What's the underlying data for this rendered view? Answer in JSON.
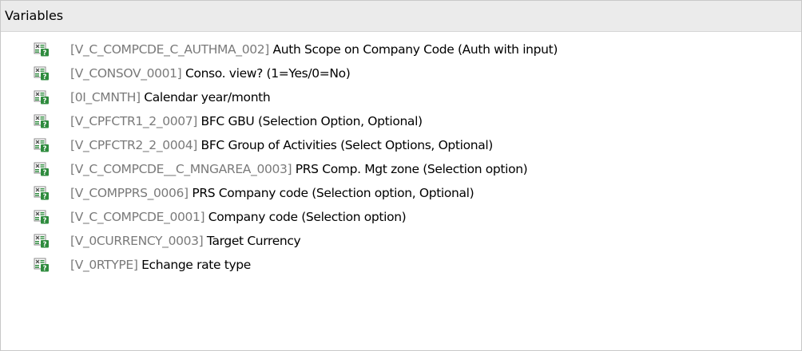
{
  "panel": {
    "title": "Variables"
  },
  "variables": [
    {
      "tech": "[V_C_COMPCDE_C_AUTHMA_002]",
      "description": "Auth Scope on Company Code (Auth with input)"
    },
    {
      "tech": "[V_CONSOV_0001]",
      "description": "Conso. view? (1=Yes/0=No)"
    },
    {
      "tech": "[0I_CMNTH]",
      "description": "Calendar year/month"
    },
    {
      "tech": "[V_CPFCTR1_2_0007]",
      "description": "BFC GBU (Selection Option, Optional)"
    },
    {
      "tech": "[V_CPFCTR2_2_0004]",
      "description": "BFC Group of Activities (Select Options, Optional)"
    },
    {
      "tech": "[V_C_COMPCDE__C_MNGAREA_0003]",
      "description": "PRS Comp. Mgt zone (Selection option)"
    },
    {
      "tech": "[V_COMPPRS_0006]",
      "description": "PRS Company code (Selection option, Optional)"
    },
    {
      "tech": "[V_C_COMPCDE_0001]",
      "description": "Company code (Selection option)"
    },
    {
      "tech": "[V_0CURRENCY_0003]",
      "description": "Target Currency"
    },
    {
      "tech": "[V_0RTYPE]",
      "description": "Echange rate type"
    }
  ],
  "icons": {
    "variable": "variable-icon"
  },
  "colors": {
    "header_bg": "#ebebeb",
    "tech_text": "#7a7a7a",
    "desc_text": "#000000",
    "icon_green": "#2e8b3d"
  }
}
